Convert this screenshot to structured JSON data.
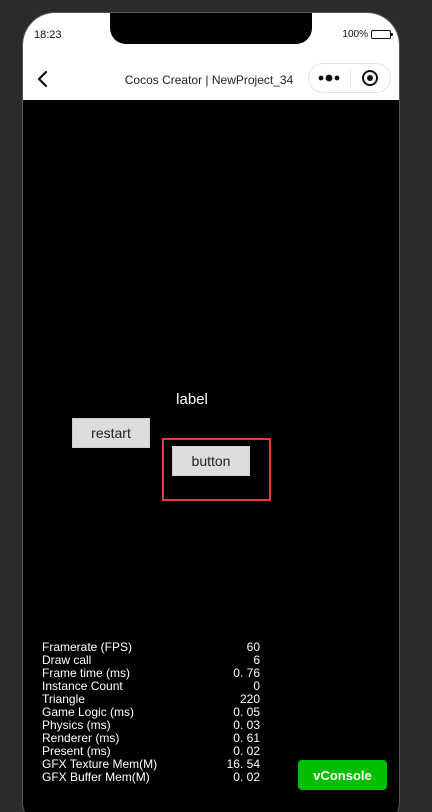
{
  "status_bar": {
    "time": "18:23",
    "battery": "100%"
  },
  "nav_bar": {
    "title": "Cocos Creator | NewProject_34",
    "back_icon": "chevron-left-icon",
    "more_icon": "more-dots-icon",
    "close_icon": "target-circle-icon"
  },
  "game": {
    "label_text": "label",
    "restart_label": "restart",
    "button_label": "button",
    "highlight_color": "#e23b3b"
  },
  "stats": [
    {
      "name": "Framerate (FPS)",
      "value": "60"
    },
    {
      "name": "Draw call",
      "value": "6"
    },
    {
      "name": "Frame time (ms)",
      "value": "0. 76"
    },
    {
      "name": "Instance Count",
      "value": "0"
    },
    {
      "name": "Triangle",
      "value": "220"
    },
    {
      "name": "Game Logic (ms)",
      "value": "0. 05"
    },
    {
      "name": "Physics (ms)",
      "value": "0. 03"
    },
    {
      "name": "Renderer (ms)",
      "value": "0. 61"
    },
    {
      "name": "Present (ms)",
      "value": "0. 02"
    },
    {
      "name": "GFX Texture Mem(M)",
      "value": "16. 54"
    },
    {
      "name": "GFX Buffer Mem(M)",
      "value": "0. 02"
    }
  ],
  "vconsole": {
    "label": "vConsole",
    "color": "#04be02"
  }
}
